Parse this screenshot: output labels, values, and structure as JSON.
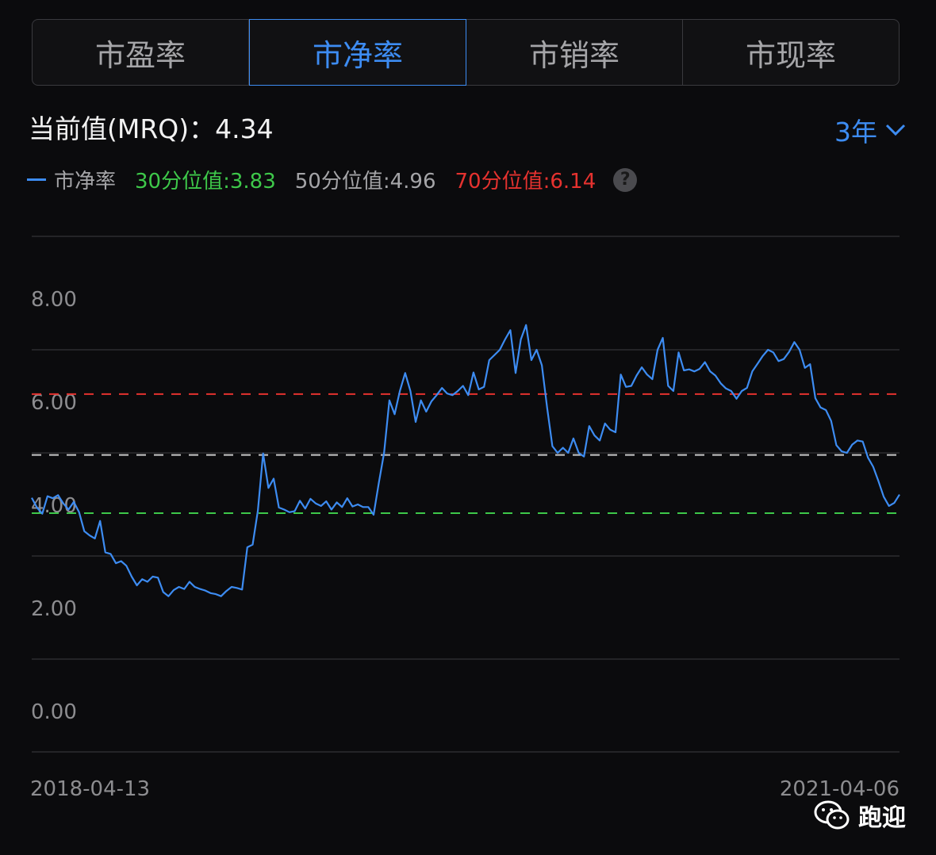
{
  "tabs": [
    {
      "label": "市盈率"
    },
    {
      "label": "市净率"
    },
    {
      "label": "市销率"
    },
    {
      "label": "市现率"
    }
  ],
  "active_tab": 1,
  "current_value_text": "当前值(MRQ)：4.34",
  "range_selector": {
    "label": "3年"
  },
  "legend": {
    "series_name": "市净率",
    "p30": "30分位值:3.83",
    "p50": "50分位值:4.96",
    "p70": "70分位值:6.14",
    "help": "?"
  },
  "dates": {
    "start": "2018-04-13",
    "end": "2021-04-06"
  },
  "watermark": {
    "text": "跑迎",
    "icon": "wechat-icon"
  },
  "colors": {
    "accent": "#3d8cf2",
    "p30": "#3ec84a",
    "p50": "#c8c8c8",
    "p70": "#e5322f"
  },
  "chart_data": {
    "type": "line",
    "title": "",
    "xlabel": "",
    "ylabel": "",
    "ylim": [
      -0.8,
      9.2
    ],
    "yticks": [
      0,
      2,
      4,
      6,
      8
    ],
    "ytick_labels": [
      "0.00",
      "2.00",
      "4.00",
      "6.00",
      "8.00"
    ],
    "x": [
      "2018-04-13",
      "2021-04-06"
    ],
    "reference_lines": [
      {
        "name": "30分位值",
        "value": 3.83,
        "color": "#3ec84a"
      },
      {
        "name": "50分位值",
        "value": 4.96,
        "color": "#c8c8c8"
      },
      {
        "name": "70分位值",
        "value": 6.14,
        "color": "#e5322f"
      }
    ],
    "series": [
      {
        "name": "市净率",
        "color": "#3d8cf2",
        "values": [
          4.13,
          3.94,
          3.82,
          4.16,
          4.12,
          4.18,
          4.02,
          3.9,
          4.05,
          3.85,
          3.48,
          3.4,
          3.34,
          3.68,
          3.07,
          3.04,
          2.86,
          2.9,
          2.81,
          2.6,
          2.43,
          2.55,
          2.5,
          2.6,
          2.58,
          2.3,
          2.22,
          2.34,
          2.4,
          2.36,
          2.5,
          2.4,
          2.36,
          2.33,
          2.28,
          2.26,
          2.22,
          2.32,
          2.4,
          2.38,
          2.35,
          3.17,
          3.22,
          3.88,
          4.99,
          4.32,
          4.5,
          3.94,
          3.9,
          3.85,
          3.87,
          4.07,
          3.92,
          4.11,
          4.02,
          3.97,
          4.06,
          3.9,
          4.04,
          3.95,
          4.12,
          3.96,
          4.0,
          3.95,
          3.95,
          3.8,
          4.42,
          5.0,
          6.02,
          5.75,
          6.2,
          6.55,
          6.2,
          5.6,
          6.02,
          5.8,
          6.0,
          6.12,
          6.26,
          6.15,
          6.12,
          6.2,
          6.3,
          6.12,
          6.56,
          6.23,
          6.28,
          6.8,
          6.9,
          7.0,
          7.2,
          7.38,
          6.55,
          7.2,
          7.48,
          6.8,
          7.0,
          6.7,
          5.87,
          5.13,
          5.0,
          5.1,
          5.0,
          5.28,
          5.0,
          4.93,
          5.52,
          5.34,
          5.24,
          5.57,
          5.45,
          5.4,
          6.52,
          6.28,
          6.3,
          6.5,
          6.66,
          6.52,
          6.43,
          7.0,
          7.23,
          6.3,
          6.2,
          6.95,
          6.6,
          6.62,
          6.58,
          6.63,
          6.76,
          6.58,
          6.5,
          6.35,
          6.25,
          6.2,
          6.05,
          6.2,
          6.26,
          6.58,
          6.73,
          6.88,
          7.0,
          6.95,
          6.78,
          6.82,
          6.96,
          7.15,
          7.0,
          6.65,
          6.72,
          6.06,
          5.88,
          5.83,
          5.62,
          5.15,
          5.03,
          5.0,
          5.16,
          5.24,
          5.22,
          4.91,
          4.73,
          4.45,
          4.15,
          3.97,
          4.03,
          4.19
        ]
      }
    ]
  }
}
